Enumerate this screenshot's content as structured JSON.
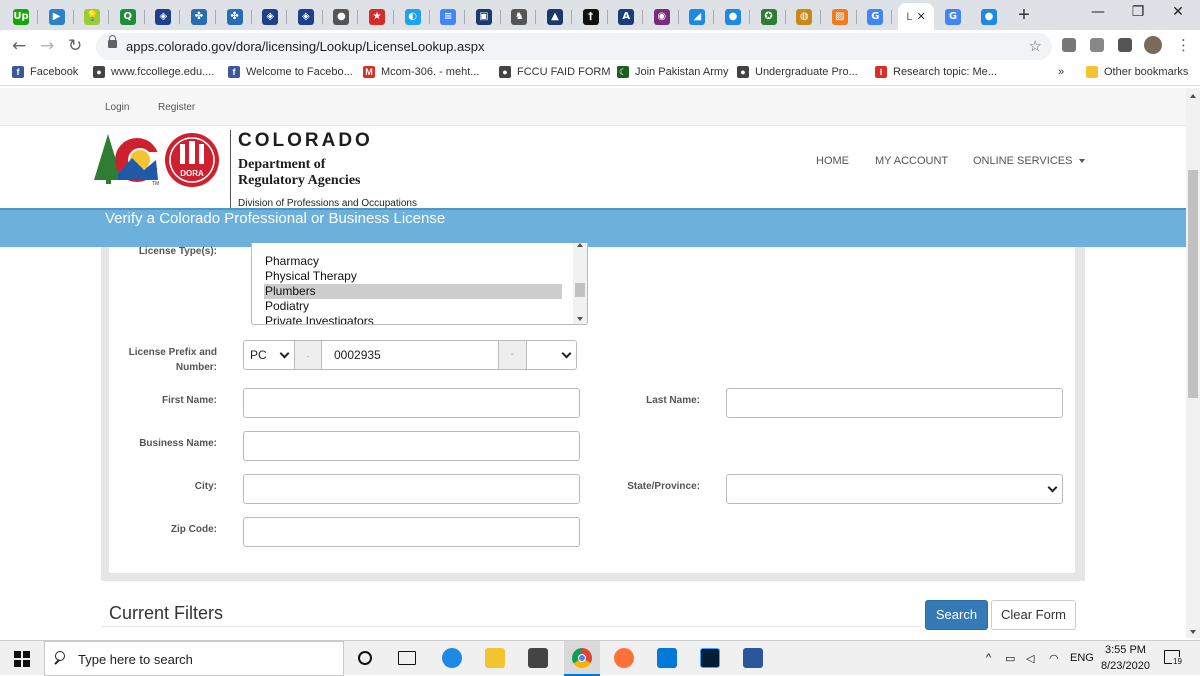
{
  "browser": {
    "tabs": [
      {
        "icon": "Up",
        "color": "#14a800"
      },
      {
        "icon": "▶",
        "color": "#2b82c6"
      },
      {
        "icon": "💡",
        "color": "#9acd32"
      },
      {
        "icon": "Q",
        "color": "#1f8e3c"
      },
      {
        "icon": "◈",
        "color": "#1e3f8a"
      },
      {
        "icon": "✤",
        "color": "#2a6cb3"
      },
      {
        "icon": "✤",
        "color": "#2a6cb3"
      },
      {
        "icon": "◈",
        "color": "#1e3f8a"
      },
      {
        "icon": "◈",
        "color": "#1e3f8a"
      },
      {
        "icon": "●",
        "color": "#555555"
      },
      {
        "icon": "★",
        "color": "#d62b2b"
      },
      {
        "icon": "◐",
        "color": "#1da1f2"
      },
      {
        "icon": "≡",
        "color": "#4285f4"
      },
      {
        "icon": "▣",
        "color": "#1a3a6a"
      },
      {
        "icon": "♞",
        "color": "#555555"
      },
      {
        "icon": "▲",
        "color": "#1a3a6a"
      },
      {
        "icon": "†",
        "color": "#111111"
      },
      {
        "icon": "A",
        "color": "#1b3b7a"
      },
      {
        "icon": "◉",
        "color": "#7a2b7a"
      },
      {
        "icon": "◢",
        "color": "#1e88e5"
      },
      {
        "icon": "●",
        "color": "#1e88e5"
      },
      {
        "icon": "✪",
        "color": "#2e7d32"
      },
      {
        "icon": "◍",
        "color": "#c68a1b"
      },
      {
        "icon": "▨",
        "color": "#f27a1a"
      },
      {
        "icon": "G",
        "color": "#4285f4"
      }
    ],
    "active_tab": {
      "letter": "L",
      "close": "✕"
    },
    "extra_tabs": [
      {
        "icon": "G",
        "color": "#4285f4"
      },
      {
        "icon": "●",
        "color": "#1e88e5"
      }
    ],
    "new_tab": "+",
    "window_controls": [
      "—",
      "❐",
      "✕"
    ],
    "url": "apps.colorado.gov/dora/licensing/Lookup/LicenseLookup.aspx"
  },
  "bookmarks": [
    {
      "label": "Facebook",
      "icon": "f",
      "color": "#3b5998"
    },
    {
      "label": "www.fccollege.edu....",
      "icon": "●",
      "color": "#444444"
    },
    {
      "label": "Welcome to Facebo...",
      "icon": "f",
      "color": "#3b5998"
    },
    {
      "label": "Mcom-306. - meht...",
      "icon": "M",
      "color": "#d93025"
    },
    {
      "label": "FCCU FAID FORM",
      "icon": "●",
      "color": "#444444"
    },
    {
      "label": "Join Pakistan Army",
      "icon": "☾",
      "color": "#1b5e20"
    },
    {
      "label": "Undergraduate Pro...",
      "icon": "●",
      "color": "#444444"
    },
    {
      "label": "Research topic: Me...",
      "icon": "⁝",
      "color": "#d93025"
    }
  ],
  "bookmarks_more": "»",
  "other_bookmarks": "Other bookmarks",
  "site": {
    "top_links": {
      "login": "Login",
      "register": "Register"
    },
    "logo_badge": "DORA",
    "logo_tm": "TM",
    "org": {
      "state": "COLORADO",
      "dept_line1": "Department of",
      "dept_line2": "Regulatory Agencies",
      "division": "Division of Professions and Occupations"
    },
    "nav": {
      "home": "HOME",
      "account": "MY ACCOUNT",
      "services": "ONLINE SERVICES"
    },
    "banner_title": "Verify a Colorado Professional or Business License"
  },
  "form": {
    "license_types_label": "License Type(s):",
    "license_types": [
      {
        "label": "Pharmacy",
        "selected": false
      },
      {
        "label": "Physical Therapy",
        "selected": false
      },
      {
        "label": "Plumbers",
        "selected": true
      },
      {
        "label": "Podiatry",
        "selected": false
      },
      {
        "label": "Private Investigators",
        "selected": false
      }
    ],
    "prefix_label_1": "License Prefix and",
    "prefix_label_2": "Number:",
    "prefix_value": "PC",
    "prefix_sep_1": ".",
    "license_number": "0002935",
    "prefix_sep_2": "-",
    "suffix_value": "",
    "first_name_label": "First Name:",
    "first_name": "",
    "last_name_label": "Last Name:",
    "last_name": "",
    "business_name_label": "Business Name:",
    "business_name": "",
    "city_label": "City:",
    "city": "",
    "state_label": "State/Province:",
    "state_value": "",
    "zip_label": "Zip Code:",
    "zip": ""
  },
  "filters_title": "Current Filters",
  "buttons": {
    "search": "Search",
    "clear": "Clear Form"
  },
  "taskbar": {
    "search_placeholder": "Type here to search",
    "language": "ENG",
    "time": "3:55 PM",
    "date": "8/23/2020",
    "notifications": "19"
  }
}
